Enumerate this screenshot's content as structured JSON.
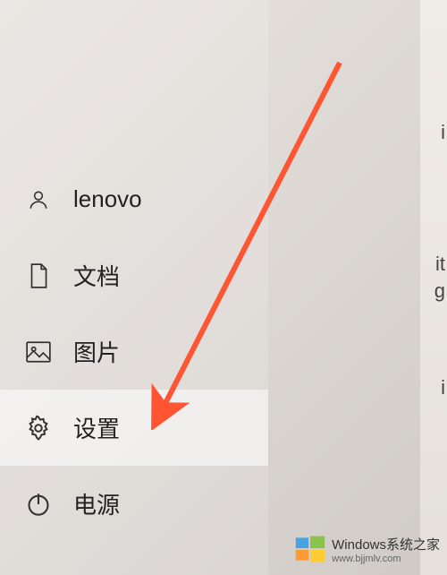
{
  "user": {
    "name": "lenovo"
  },
  "menu": {
    "documents": "文档",
    "pictures": "图片",
    "settings": "设置",
    "power": "电源"
  },
  "watermark": {
    "title": "Windows系统之家",
    "url": "www.bjjmlv.com"
  },
  "right_fragments": {
    "f1": "i",
    "f2": "it",
    "f3": "g",
    "f4": "i"
  }
}
